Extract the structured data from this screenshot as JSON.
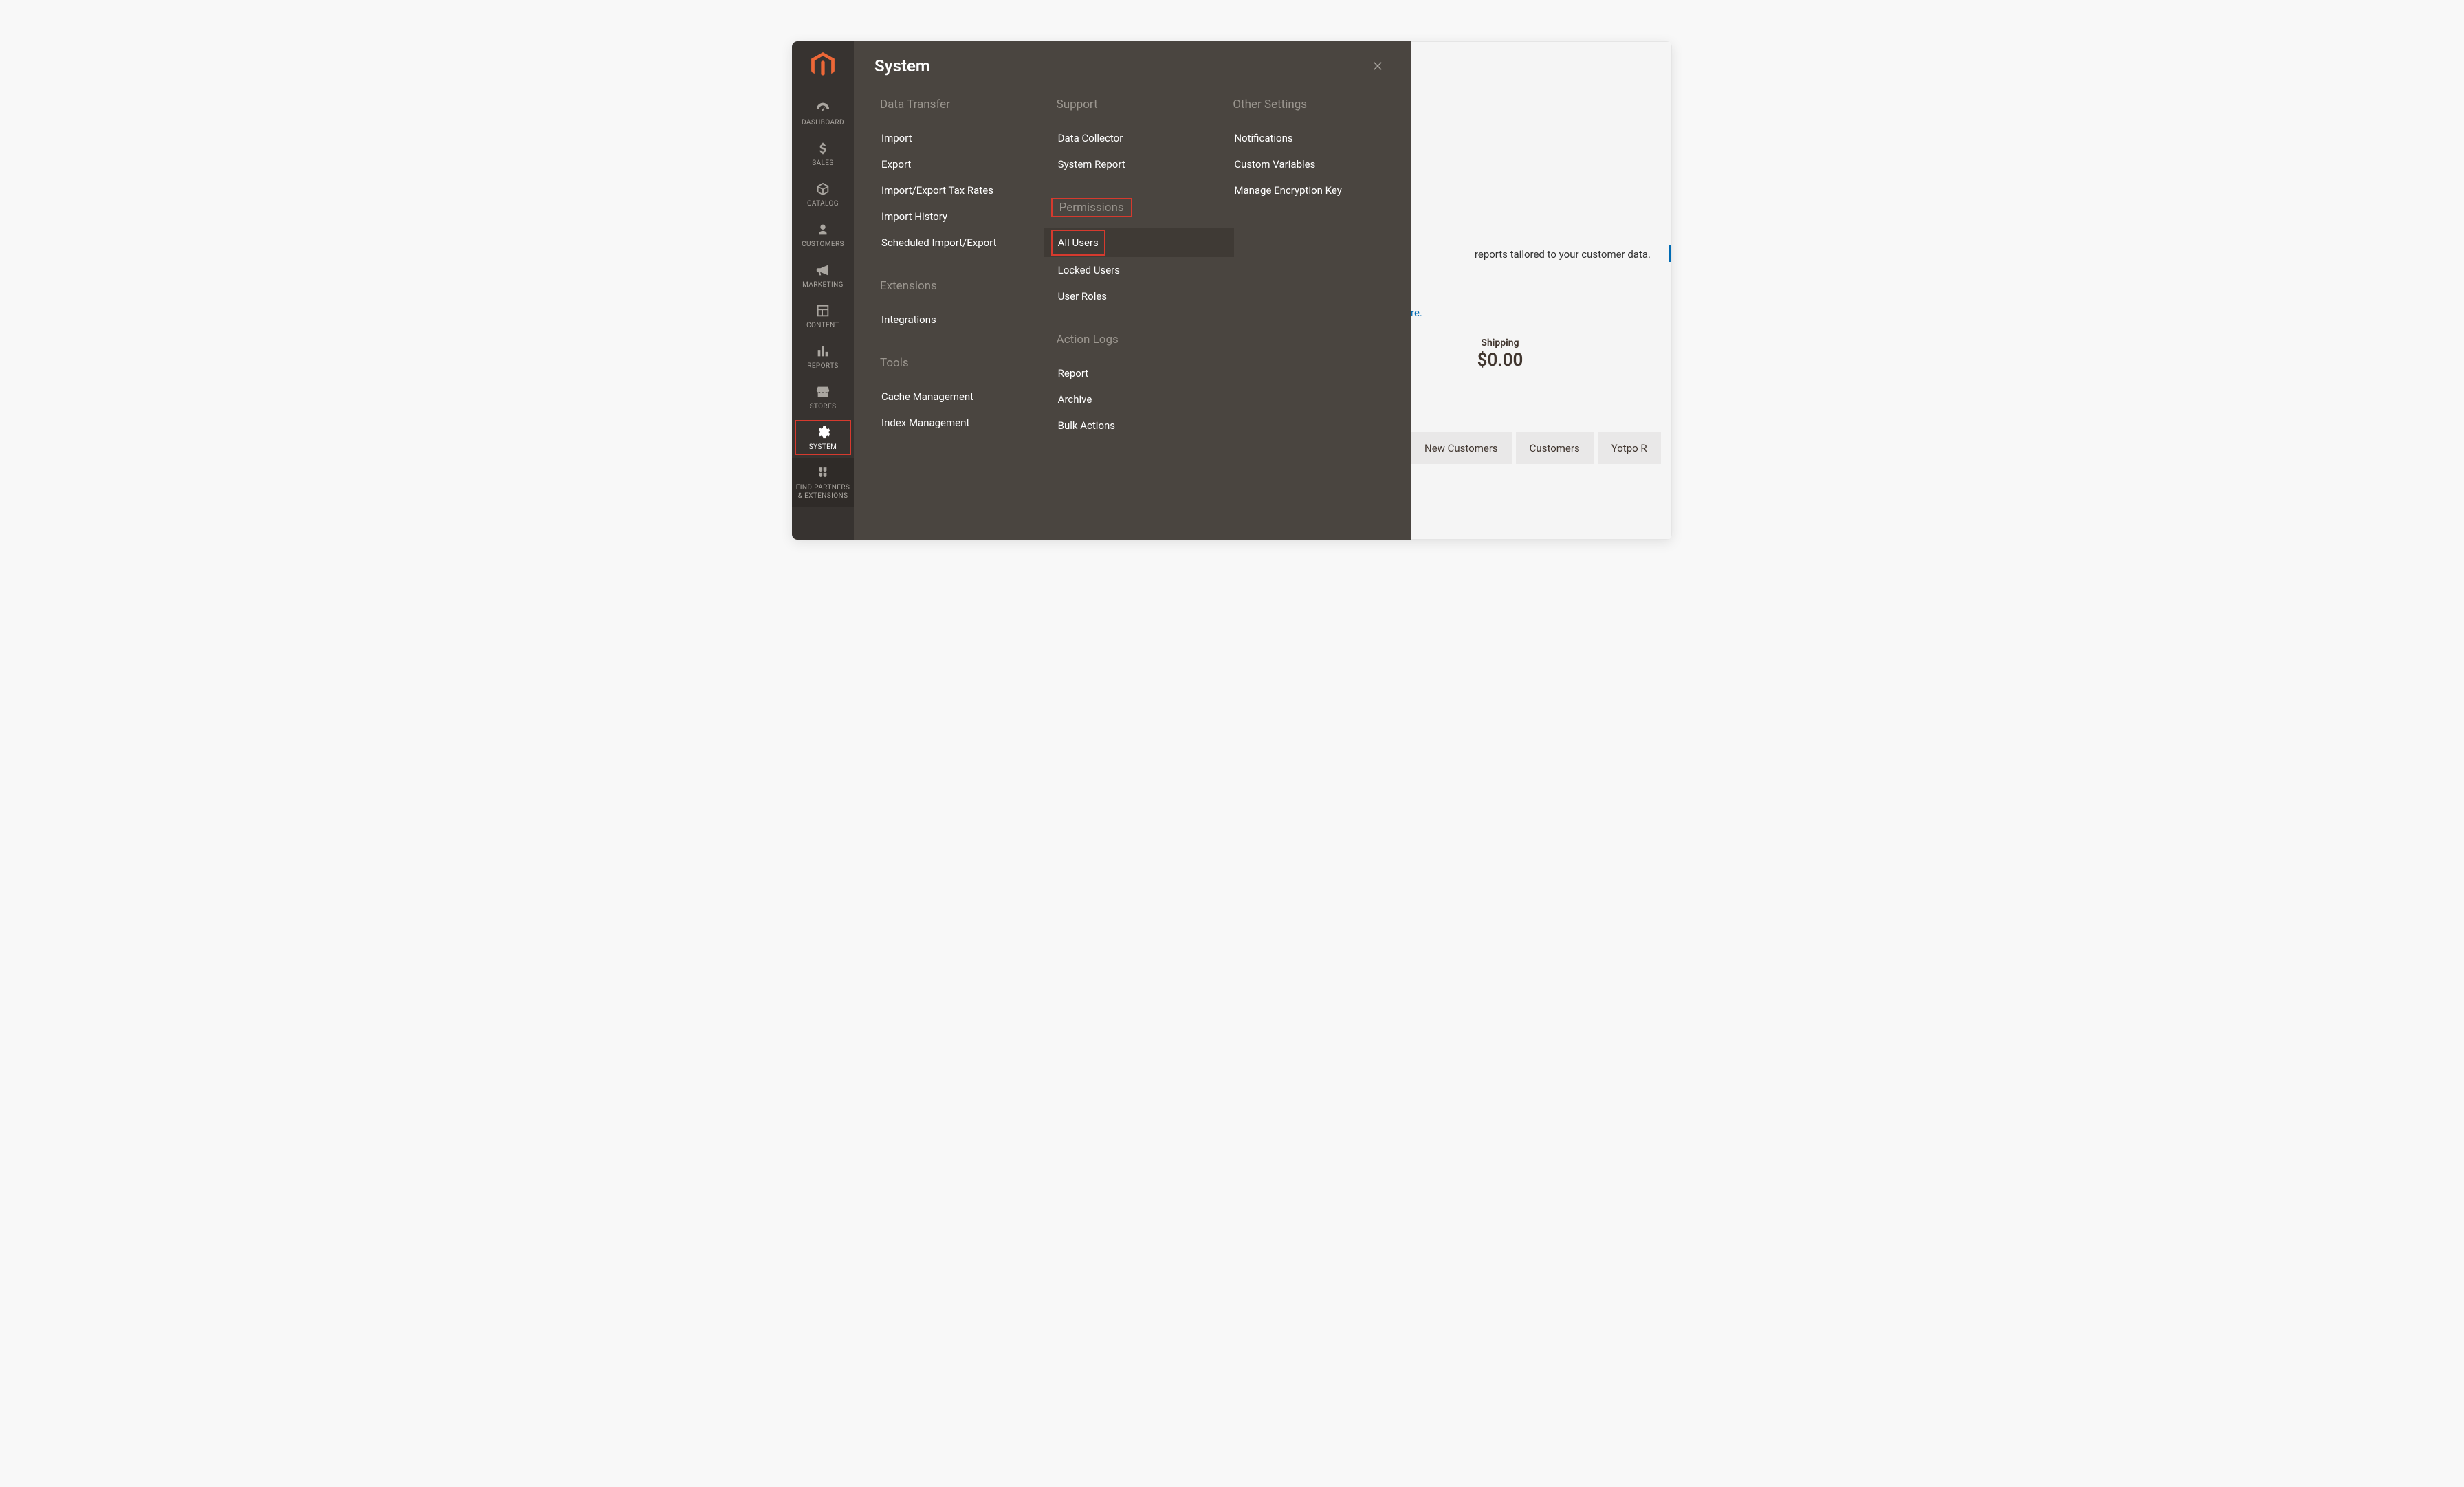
{
  "sidebar": {
    "items": [
      {
        "label": "DASHBOARD"
      },
      {
        "label": "SALES"
      },
      {
        "label": "CATALOG"
      },
      {
        "label": "CUSTOMERS"
      },
      {
        "label": "MARKETING"
      },
      {
        "label": "CONTENT"
      },
      {
        "label": "REPORTS"
      },
      {
        "label": "STORES"
      },
      {
        "label": "SYSTEM"
      },
      {
        "label": "FIND PARTNERS & EXTENSIONS"
      }
    ]
  },
  "flyout": {
    "title": "System",
    "columns": [
      {
        "groups": [
          {
            "heading": "Data Transfer",
            "items": [
              "Import",
              "Export",
              "Import/Export Tax Rates",
              "Import History",
              "Scheduled Import/Export"
            ]
          },
          {
            "heading": "Extensions",
            "items": [
              "Integrations"
            ]
          },
          {
            "heading": "Tools",
            "items": [
              "Cache Management",
              "Index Management"
            ]
          }
        ]
      },
      {
        "groups": [
          {
            "heading": "Support",
            "items": [
              "Data Collector",
              "System Report"
            ]
          },
          {
            "heading": "Permissions",
            "heading_highlight": true,
            "items": [
              "All Users",
              "Locked Users",
              "User Roles"
            ],
            "item_highlight_index": 0
          },
          {
            "heading": "Action Logs",
            "items": [
              "Report",
              "Archive",
              "Bulk Actions"
            ]
          }
        ]
      },
      {
        "groups": [
          {
            "heading": "Other Settings",
            "items": [
              "Notifications",
              "Custom Variables",
              "Manage Encryption Key"
            ]
          }
        ]
      }
    ]
  },
  "page": {
    "info_fragment": "reports tailored to your customer data.",
    "link_fragment": "re.",
    "kpi": {
      "label": "Shipping",
      "value": "$0.00"
    },
    "tabs": [
      "New Customers",
      "Customers",
      "Yotpo R"
    ]
  }
}
